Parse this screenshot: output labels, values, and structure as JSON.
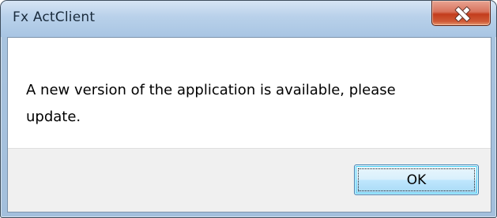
{
  "window": {
    "title": "Fx ActClient",
    "close_icon": "close-icon",
    "close_color": "#c33d1d"
  },
  "dialog": {
    "message": "A new version of the application is available, please update.",
    "ok_label": "OK"
  }
}
